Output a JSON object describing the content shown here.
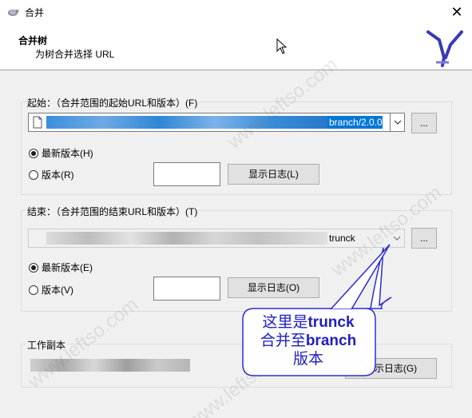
{
  "window": {
    "title": "合并",
    "close_glyph": "✕"
  },
  "header": {
    "title": "合并树",
    "subtitle": "为树合并选择 URL"
  },
  "start": {
    "group_label": "起始：（合并范围的起始URL和版本）(F)",
    "url_tail": "branch/2.0.0",
    "browse_label": "...",
    "head_label": "最新版本(H)",
    "rev_label": "版本(R)",
    "log_label": "显示日志(L)",
    "head_selected": true
  },
  "end": {
    "group_label": "结束：（合并范围的结束URL和版本）(T)",
    "url_tail": "trunck",
    "browse_label": "...",
    "head_label": "最新版本(E)",
    "rev_label": "版本(V)",
    "log_label": "显示日志(O)",
    "head_selected": true
  },
  "working_copy": {
    "group_label": "工作副本",
    "log_label": "显示日志(G)"
  },
  "annotation": {
    "line1_a": "这里是",
    "line1_b": "trunck",
    "line2_a": "合并至",
    "line2_b": "branch",
    "line3": "版本"
  },
  "watermark": "www.leftso.com",
  "colors": {
    "selection": "#0078d7",
    "callout_text": "#2020c0",
    "callout_border": "#2a2ad0",
    "logo": "#3a3ab8"
  },
  "icons": {
    "app": "tortoise-icon",
    "logo": "merge-logo",
    "cursor": "mouse-cursor-icon",
    "file": "document-icon",
    "dropdown": "chevron-down-icon"
  }
}
